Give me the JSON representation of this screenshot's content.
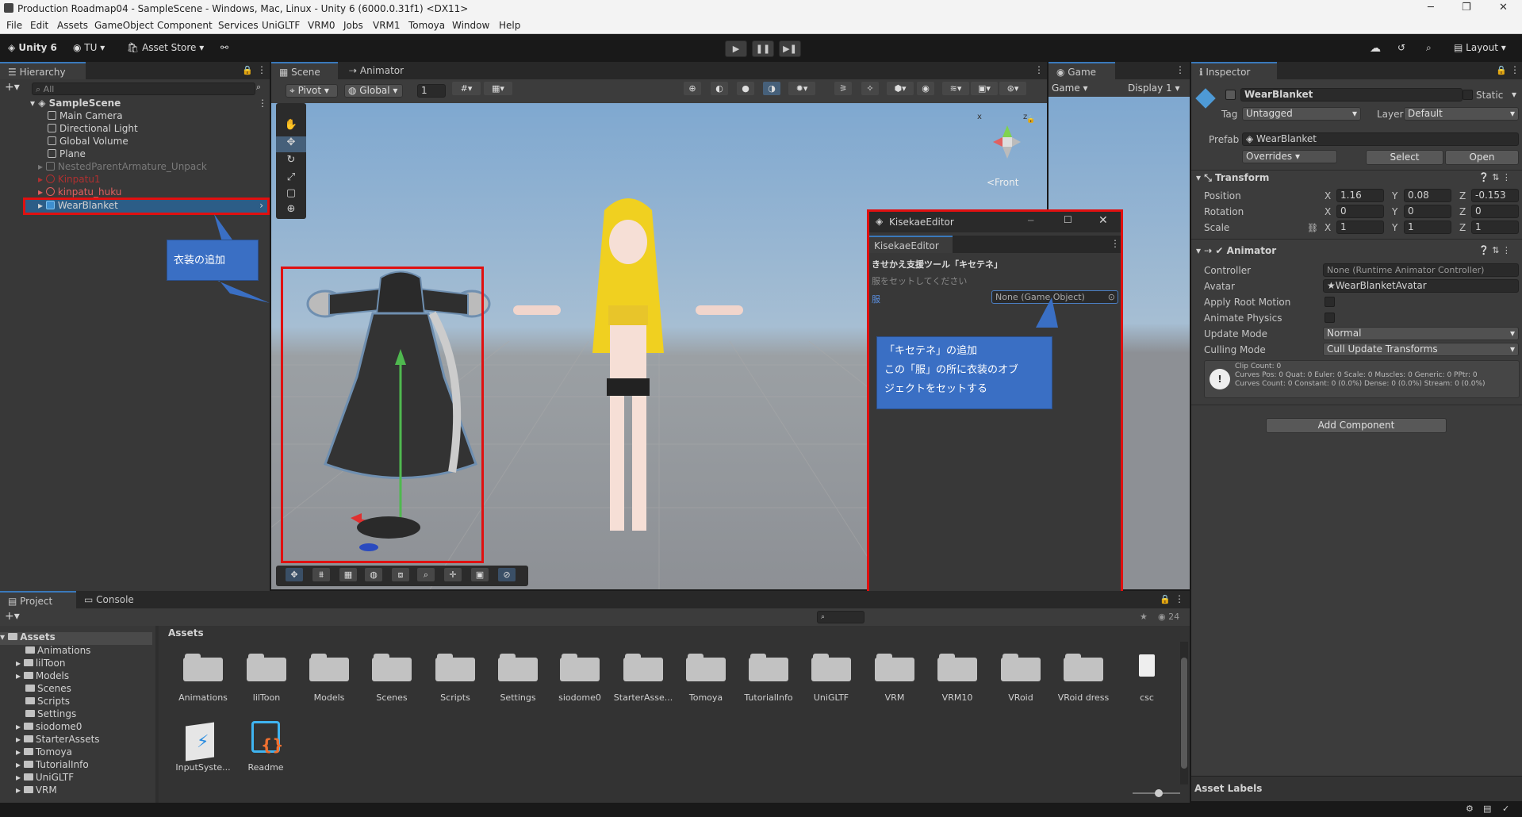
{
  "window": {
    "title": "Production Roadmap04 - SampleScene - Windows, Mac, Linux - Unity 6 (6000.0.31f1) <DX11>"
  },
  "menu": [
    "File",
    "Edit",
    "Assets",
    "GameObject",
    "Component",
    "Services",
    "UniGLTF",
    "VRM0",
    "Jobs",
    "VRM1",
    "Tomoya",
    "Window",
    "Help"
  ],
  "toolbar": {
    "unity": "Unity 6",
    "account": "TU",
    "asset_store": "Asset Store",
    "layout": "Layout"
  },
  "hierarchy": {
    "tab": "Hierarchy",
    "search": "All",
    "scene": "SampleScene",
    "items": [
      "Main Camera",
      "Directional Light",
      "Global Volume",
      "Plane",
      "NestedParentArmature_Unpack",
      "Kinpatu1",
      "kinpatu_huku",
      "WearBlanket"
    ]
  },
  "scene": {
    "tab": "Scene",
    "tab2": "Animator",
    "pivot": "Pivot",
    "global": "Global",
    "grid": "1",
    "front": "<Front",
    "callout": "衣装の追加"
  },
  "game": {
    "tab": "Game",
    "mode": "Game",
    "display": "Display 1"
  },
  "kisekae": {
    "title": "KisekaeEditor",
    "tab": "KisekaeEditor",
    "heading": "きせかえ支援ツール「キセテネ」",
    "hint": "服をセットしてください",
    "field_label": "服",
    "field_value": "None (Game Object)",
    "callout_l1": "「キセテネ」の追加",
    "callout_l2": "この「服」の所に衣装のオブ",
    "callout_l3": "ジェクトをセットする"
  },
  "inspector": {
    "tab": "Inspector",
    "name": "WearBlanket",
    "static": "Static",
    "tag_label": "Tag",
    "tag": "Untagged",
    "layer_label": "Layer",
    "layer": "Default",
    "prefab_label": "Prefab",
    "prefab": "WearBlanket",
    "overrides": "Overrides",
    "select": "Select",
    "open": "Open",
    "transform": "Transform",
    "position": "Position",
    "rotation": "Rotation",
    "scale": "Scale",
    "pos": {
      "x": "1.16",
      "y": "0.08",
      "z": "-0.153"
    },
    "rot": {
      "x": "0",
      "y": "0",
      "z": "0"
    },
    "scl": {
      "x": "1",
      "y": "1",
      "z": "1"
    },
    "animator": "Animator",
    "controller_label": "Controller",
    "controller": "None (Runtime Animator Controller)",
    "avatar_label": "Avatar",
    "avatar": "WearBlanketAvatar",
    "apply_root": "Apply Root Motion",
    "animate_physics": "Animate Physics",
    "update_label": "Update Mode",
    "update": "Normal",
    "culling_label": "Culling Mode",
    "culling": "Cull Update Transforms",
    "info1": "Clip Count: 0",
    "info2": "Curves Pos: 0 Quat: 0 Euler: 0 Scale: 0 Muscles: 0 Generic: 0 PPtr: 0",
    "info3": "Curves Count: 0 Constant: 0 (0.0%) Dense: 0 (0.0%) Stream: 0 (0.0%)",
    "add_component": "Add Component",
    "asset_labels": "Asset Labels"
  },
  "project": {
    "tab": "Project",
    "tab2": "Console",
    "count": "24",
    "root": "Assets",
    "crumb": "Assets",
    "tree": [
      "Animations",
      "lilToon",
      "Models",
      "Scenes",
      "Scripts",
      "Settings",
      "siodome0",
      "StarterAssets",
      "Tomoya",
      "TutorialInfo",
      "UniGLTF",
      "VRM"
    ],
    "assets": [
      "Animations",
      "lilToon",
      "Models",
      "Scenes",
      "Scripts",
      "Settings",
      "siodome0",
      "StarterAsse...",
      "Tomoya",
      "TutorialInfo",
      "UniGLTF",
      "VRM",
      "VRM10",
      "VRoid",
      "VRoid dress",
      "csc"
    ],
    "assets2": [
      "InputSyste...",
      "Readme"
    ]
  },
  "axis": {
    "x": "x",
    "z": "z"
  }
}
